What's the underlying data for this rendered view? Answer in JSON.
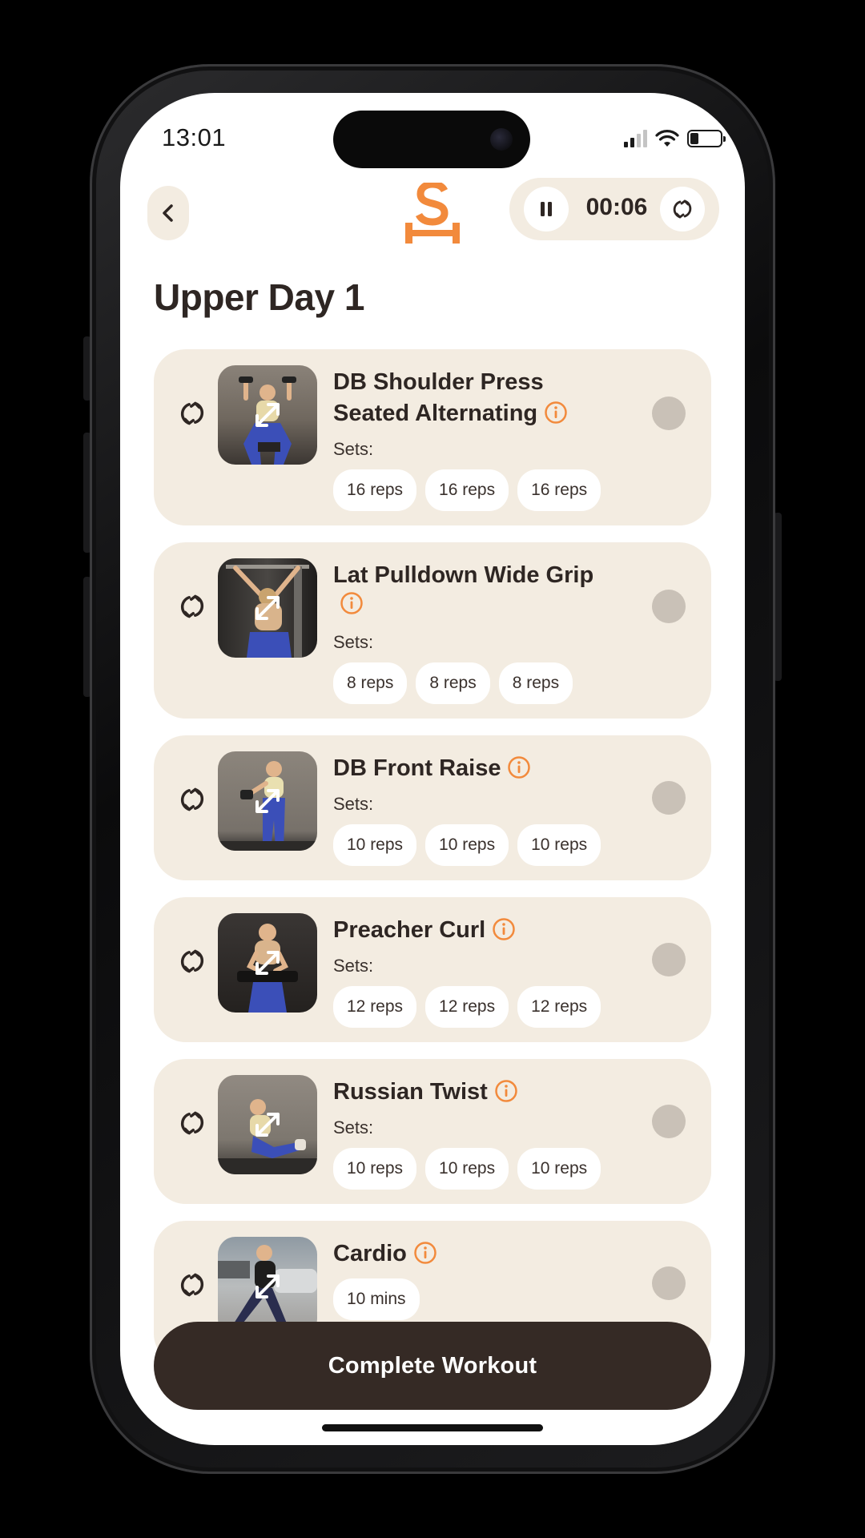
{
  "status_bar": {
    "time": "13:01"
  },
  "header": {
    "back_icon": "chevron-left-icon",
    "logo": "strength-app-logo",
    "timer": {
      "value": "00:06",
      "pause_icon": "pause-icon",
      "swap_icon": "swap-icon"
    }
  },
  "page_title": "Upper Day 1",
  "exercises": [
    {
      "name": "DB Shoulder Press Seated Alternating",
      "sets_label": "Sets:",
      "sets": [
        "16 reps",
        "16 reps",
        "16 reps"
      ],
      "done": false
    },
    {
      "name": "Lat Pulldown Wide Grip",
      "sets_label": "Sets:",
      "sets": [
        "8 reps",
        "8 reps",
        "8 reps"
      ],
      "done": false
    },
    {
      "name": "DB Front Raise",
      "sets_label": "Sets:",
      "sets": [
        "10 reps",
        "10 reps",
        "10 reps"
      ],
      "done": false
    },
    {
      "name": "Preacher Curl",
      "sets_label": "Sets:",
      "sets": [
        "12 reps",
        "12 reps",
        "12 reps"
      ],
      "done": false
    },
    {
      "name": "Russian Twist",
      "sets_label": "Sets:",
      "sets": [
        "10 reps",
        "10 reps",
        "10 reps"
      ],
      "done": false
    },
    {
      "name": "Cardio",
      "sets": [
        "10 mins"
      ],
      "done": false
    }
  ],
  "complete_button": "Complete Workout",
  "colors": {
    "accent": "#f28a3c",
    "card_bg": "#f3ece1",
    "text_dark": "#2e2623",
    "button_dark": "#352a25",
    "radio": "#c9c1b7"
  }
}
